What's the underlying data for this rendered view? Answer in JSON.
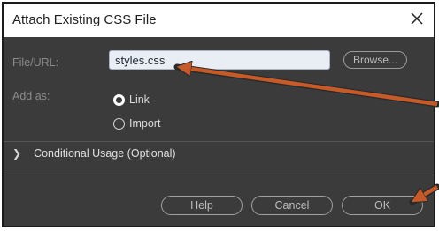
{
  "dialog": {
    "title": "Attach Existing CSS File",
    "close_icon": "close-icon"
  },
  "form": {
    "file_label": "File/URL:",
    "file_value": "styles.css",
    "browse_label": "Browse...",
    "add_as_label": "Add as:",
    "options": [
      {
        "label": "Link",
        "selected": true
      },
      {
        "label": "Import",
        "selected": false
      }
    ],
    "conditional_label": "Conditional Usage (Optional)",
    "chevron_icon": "chevron-right-icon"
  },
  "buttons": {
    "help": "Help",
    "cancel": "Cancel",
    "ok": "OK"
  },
  "annotation": {
    "arrow_color": "#c65a28"
  },
  "colors": {
    "dialog_bg": "#3b3b3b",
    "input_bg": "#e9eef4"
  }
}
